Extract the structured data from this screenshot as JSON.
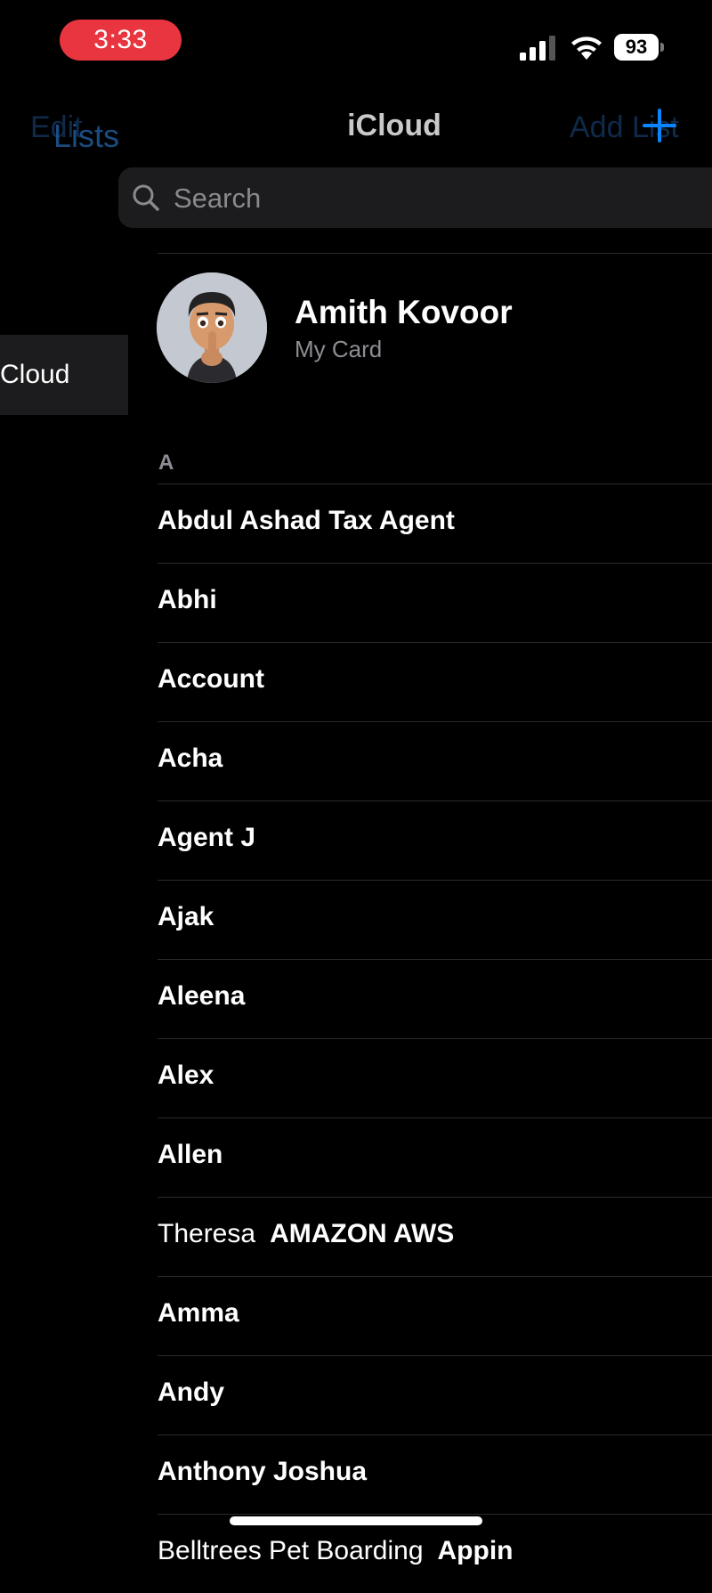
{
  "status_bar": {
    "time": "3:33",
    "battery": "93"
  },
  "nav": {
    "ghost_left": "Edit",
    "back_label": "Lists",
    "title": "iCloud",
    "ghost_right": "Add List"
  },
  "search": {
    "placeholder": "Search"
  },
  "sidebar": {
    "item_label": "Cloud"
  },
  "my_card": {
    "name": "Amith Kovoor",
    "subtitle": "My Card"
  },
  "section": {
    "letter": "A"
  },
  "contacts": [
    {
      "first": "",
      "last": "Abdul Ashad Tax Agent"
    },
    {
      "first": "",
      "last": "Abhi"
    },
    {
      "first": "",
      "last": "Account"
    },
    {
      "first": "",
      "last": "Acha"
    },
    {
      "first": "",
      "last": "Agent J"
    },
    {
      "first": "",
      "last": "Ajak"
    },
    {
      "first": "",
      "last": "Aleena"
    },
    {
      "first": "",
      "last": "Alex"
    },
    {
      "first": "",
      "last": "Allen"
    },
    {
      "first": "Theresa",
      "last": "AMAZON AWS"
    },
    {
      "first": "",
      "last": "Amma"
    },
    {
      "first": "",
      "last": "Andy"
    },
    {
      "first": "",
      "last": "Anthony Joshua"
    },
    {
      "first": "Belltrees Pet Boarding",
      "last": "Appin"
    }
  ],
  "colors": {
    "accent": "#0a84ff",
    "time_pill": "#e8353f",
    "background": "#000000"
  }
}
